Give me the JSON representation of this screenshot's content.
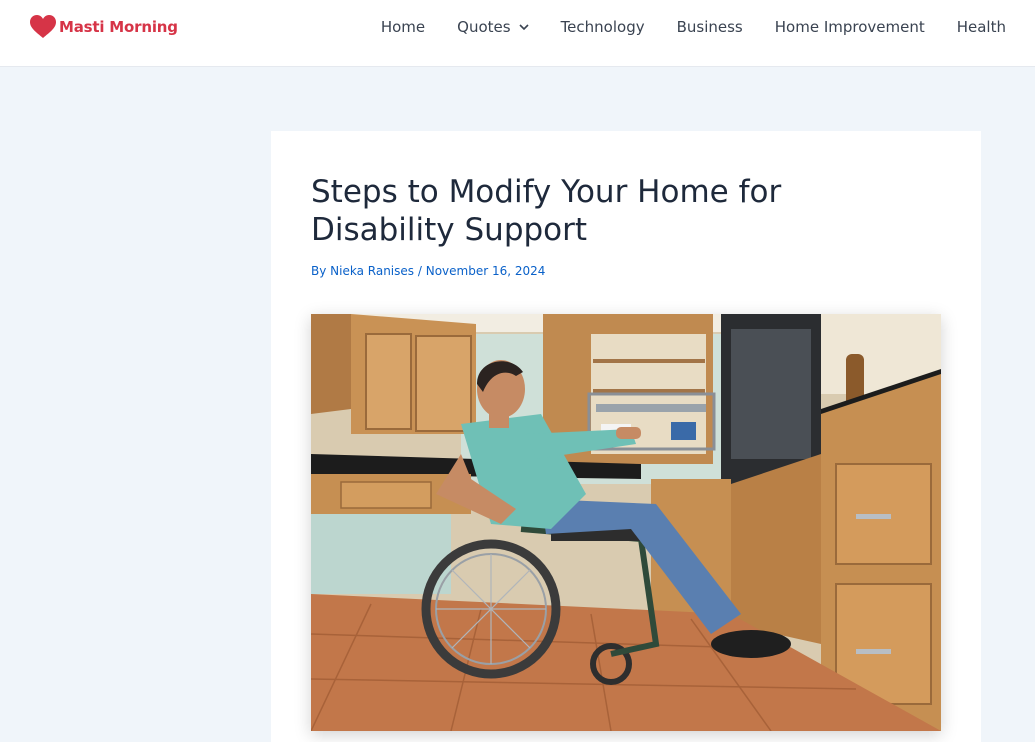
{
  "site": {
    "name": "Masti Morning",
    "brand_color": "#d63447",
    "logo_icon": "heart-icon"
  },
  "nav": {
    "items": [
      {
        "label": "Home"
      },
      {
        "label": "Quotes",
        "has_dropdown": true,
        "dropdown_icon": "chevron-down-icon"
      },
      {
        "label": "Technology"
      },
      {
        "label": "Business"
      },
      {
        "label": "Home Improvement"
      },
      {
        "label": "Health"
      }
    ]
  },
  "post": {
    "title": "Steps to Modify Your Home for Disability Support",
    "byline_prefix": "By",
    "author": "Nieka Ranises",
    "separator": "/",
    "date": "November 16, 2024",
    "link_color": "#0a61c9",
    "image_subject": "man in wheelchair reaching into a kitchen cabinet"
  }
}
